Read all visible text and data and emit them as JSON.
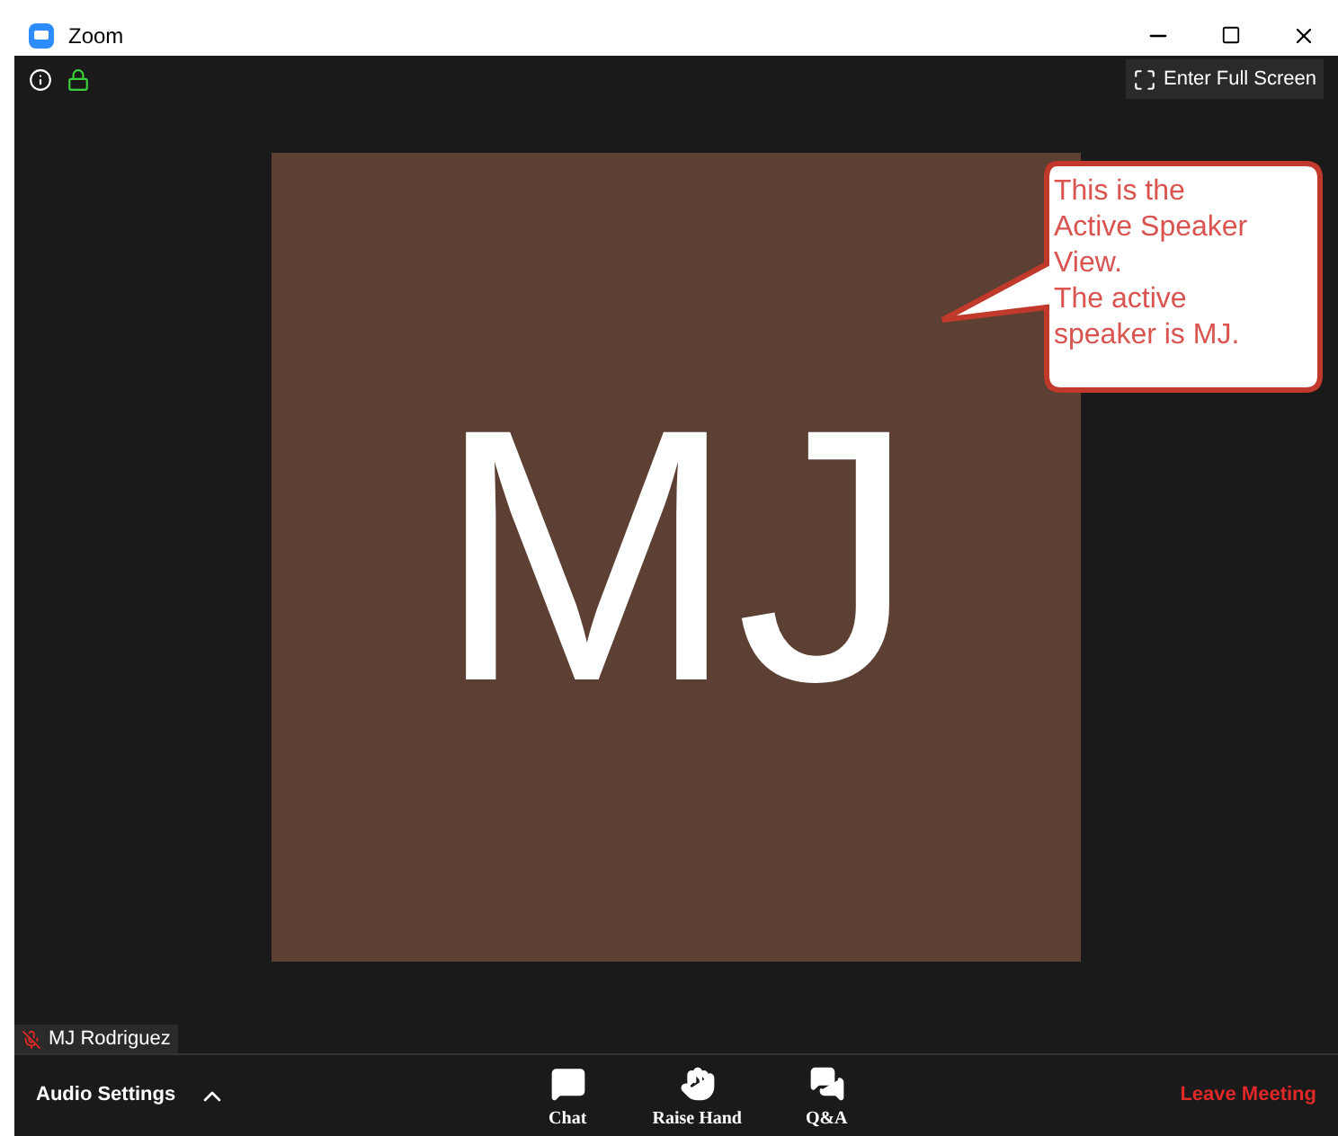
{
  "window": {
    "title": "Zoom"
  },
  "top_bar": {
    "full_screen_button": "Enter Full Screen"
  },
  "video": {
    "initials": "MJ",
    "participant": {
      "name": "MJ Rodriguez",
      "muted": true
    }
  },
  "callout": {
    "text": "This is the\nActive Speaker\nView.\nThe active\nspeaker is MJ."
  },
  "toolbar": {
    "audio_settings": "Audio Settings",
    "buttons": [
      {
        "kind": "chat",
        "label": "Chat"
      },
      {
        "kind": "hand",
        "label": "Raise Hand"
      },
      {
        "kind": "qa",
        "label": "Q&A"
      }
    ],
    "leave": "Leave Meeting"
  }
}
